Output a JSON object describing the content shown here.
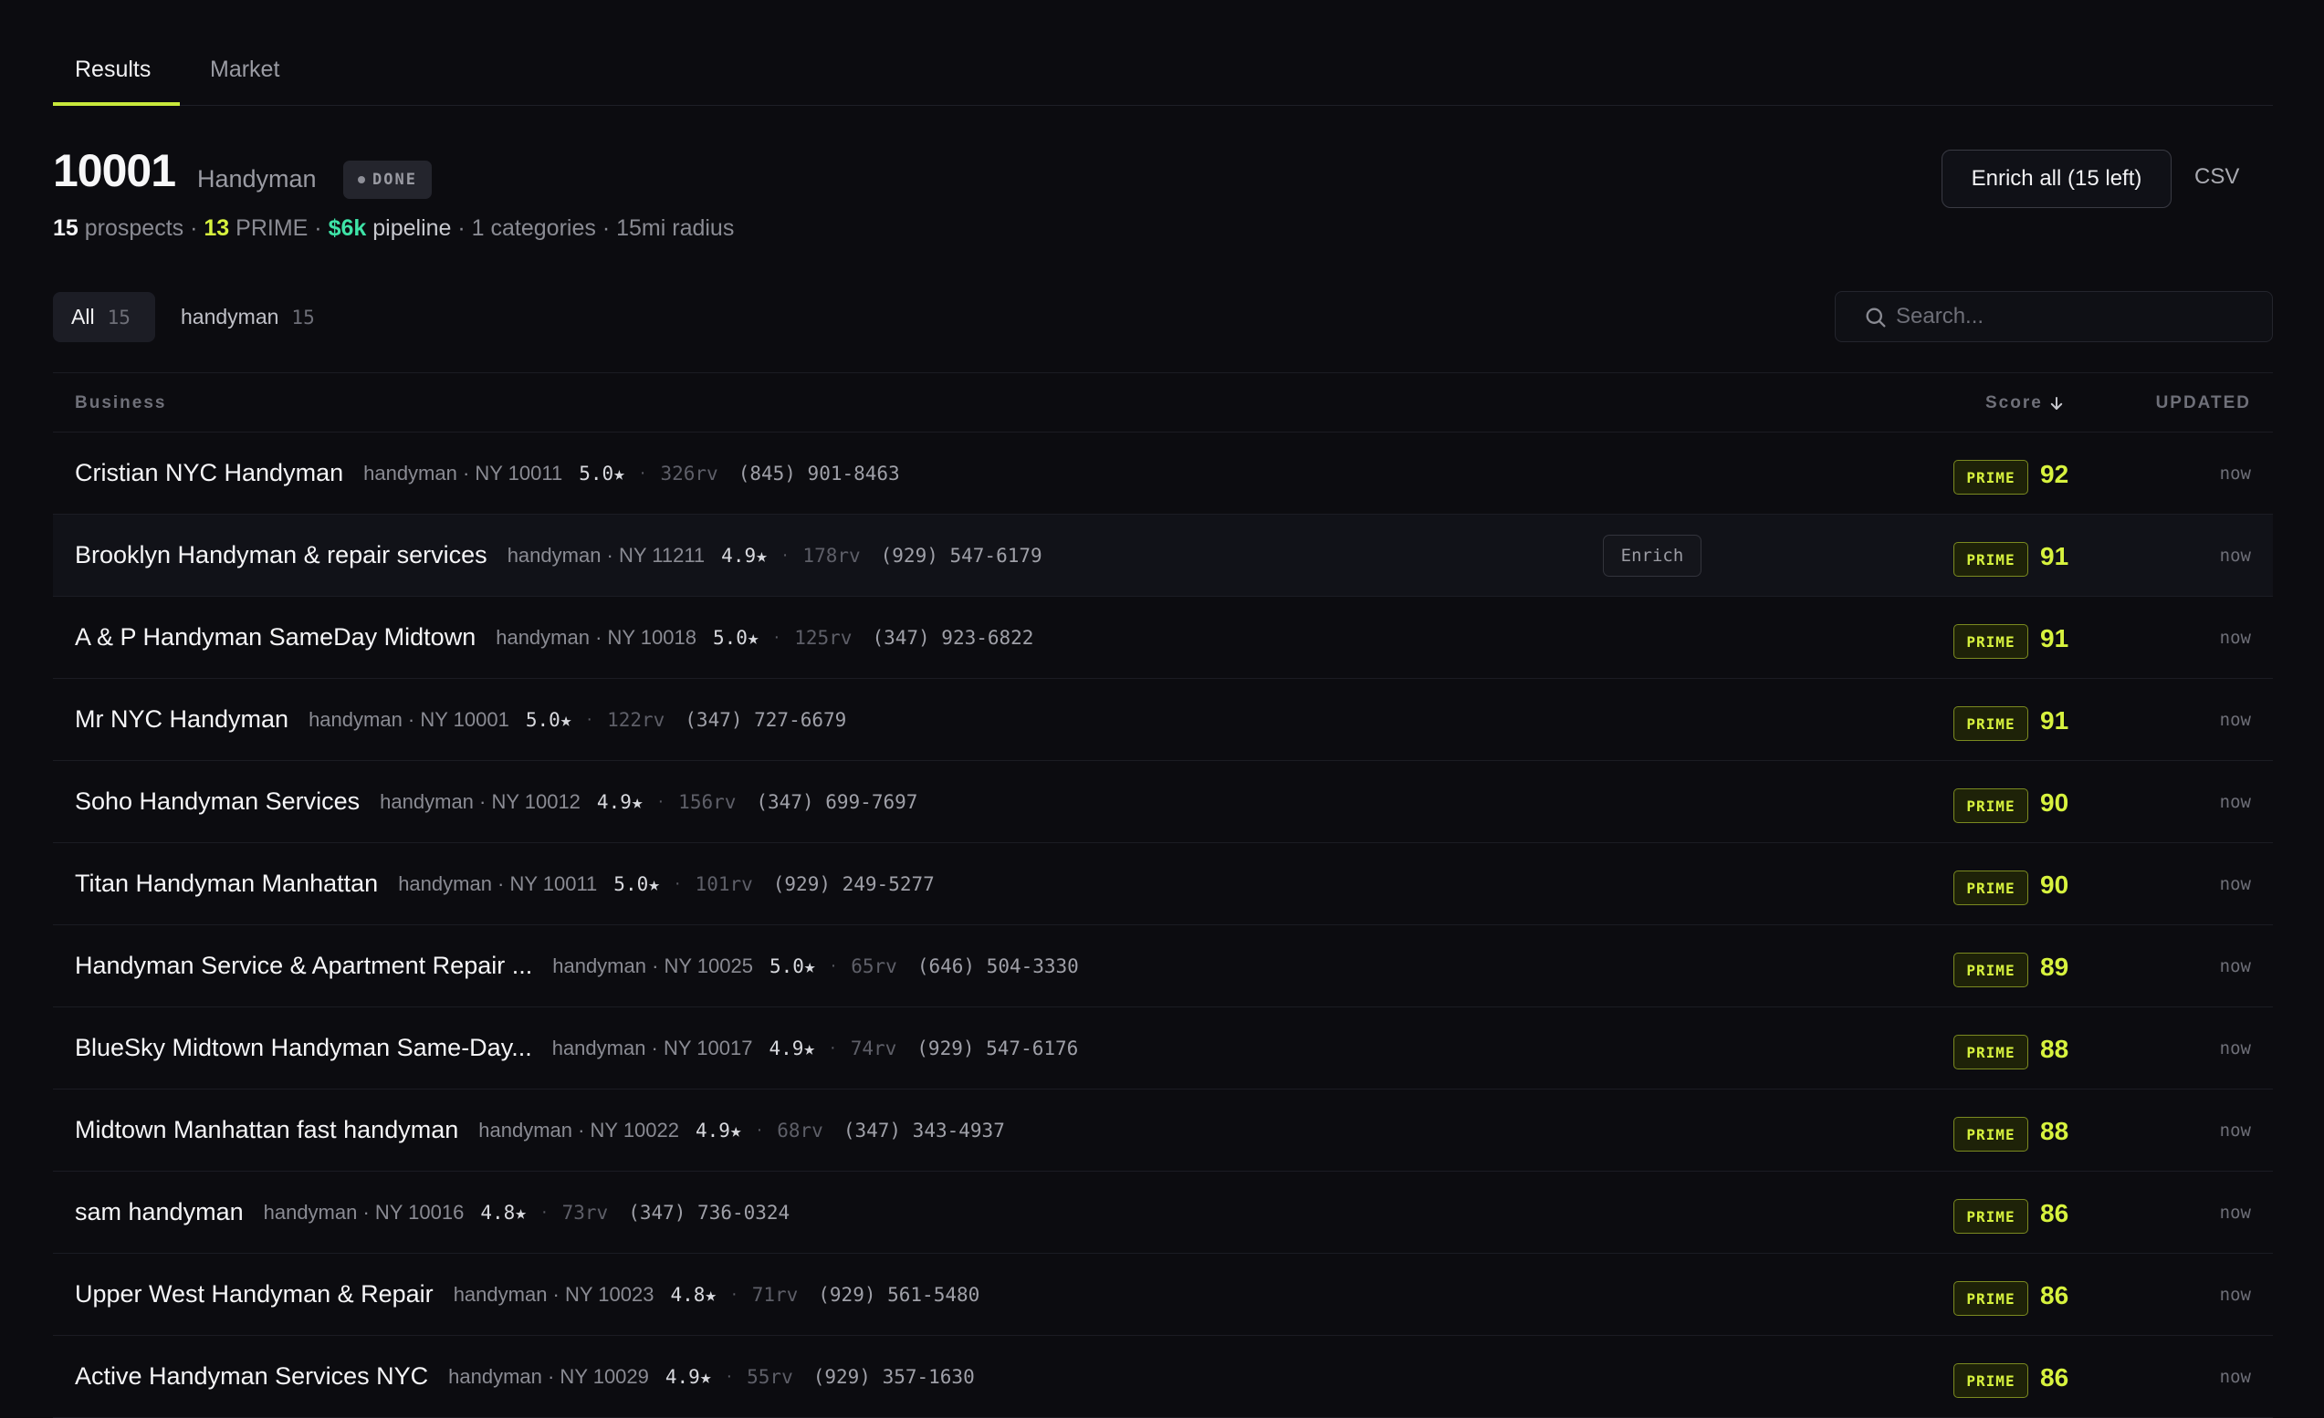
{
  "tabs": [
    {
      "label": "Results"
    },
    {
      "label": "Market"
    }
  ],
  "header": {
    "zip": "10001",
    "category": "Handyman",
    "status": "DONE",
    "summary": {
      "prospects_count": "15",
      "prospects_label": "prospects",
      "prime_count": "13",
      "prime_label": "PRIME",
      "pipeline_value": "$6k",
      "pipeline_label": "pipeline",
      "categories": "1 categories",
      "radius": "15mi radius",
      "sep": "·"
    },
    "enrich_all_label": "Enrich all (15 left)",
    "csv_label": "CSV"
  },
  "filters": [
    {
      "label": "All",
      "count": "15"
    },
    {
      "label": "handyman",
      "count": "15"
    }
  ],
  "search": {
    "placeholder": "Search..."
  },
  "table": {
    "columns": {
      "business": "Business",
      "score": "Score",
      "updated": "UPDATED"
    },
    "enrich_label": "Enrich",
    "rows": [
      {
        "name": "Cristian NYC Handyman",
        "meta": "handyman · NY 10011",
        "rating": "5.0★",
        "reviews": "326rv",
        "phone": "(845) 901-8463",
        "badge": "PRIME",
        "score": "92",
        "updated": "now"
      },
      {
        "name": "Brooklyn Handyman & repair services",
        "meta": "handyman · NY 11211",
        "rating": "4.9★",
        "reviews": "178rv",
        "phone": "(929) 547-6179",
        "badge": "PRIME",
        "score": "91",
        "updated": "now"
      },
      {
        "name": "A & P Handyman SameDay Midtown",
        "meta": "handyman · NY 10018",
        "rating": "5.0★",
        "reviews": "125rv",
        "phone": "(347) 923-6822",
        "badge": "PRIME",
        "score": "91",
        "updated": "now"
      },
      {
        "name": "Mr NYC Handyman",
        "meta": "handyman · NY 10001",
        "rating": "5.0★",
        "reviews": "122rv",
        "phone": "(347) 727-6679",
        "badge": "PRIME",
        "score": "91",
        "updated": "now"
      },
      {
        "name": "Soho Handyman Services",
        "meta": "handyman · NY 10012",
        "rating": "4.9★",
        "reviews": "156rv",
        "phone": "(347) 699-7697",
        "badge": "PRIME",
        "score": "90",
        "updated": "now"
      },
      {
        "name": "Titan Handyman Manhattan",
        "meta": "handyman · NY 10011",
        "rating": "5.0★",
        "reviews": "101rv",
        "phone": "(929) 249-5277",
        "badge": "PRIME",
        "score": "90",
        "updated": "now"
      },
      {
        "name": "Handyman Service & Apartment Repair ...",
        "meta": "handyman · NY 10025",
        "rating": "5.0★",
        "reviews": "65rv",
        "phone": "(646) 504-3330",
        "badge": "PRIME",
        "score": "89",
        "updated": "now"
      },
      {
        "name": "BlueSky Midtown Handyman Same-Day...",
        "meta": "handyman · NY 10017",
        "rating": "4.9★",
        "reviews": "74rv",
        "phone": "(929) 547-6176",
        "badge": "PRIME",
        "score": "88",
        "updated": "now"
      },
      {
        "name": "Midtown Manhattan fast handyman",
        "meta": "handyman · NY 10022",
        "rating": "4.9★",
        "reviews": "68rv",
        "phone": "(347) 343-4937",
        "badge": "PRIME",
        "score": "88",
        "updated": "now"
      },
      {
        "name": "sam handyman",
        "meta": "handyman · NY 10016",
        "rating": "4.8★",
        "reviews": "73rv",
        "phone": "(347) 736-0324",
        "badge": "PRIME",
        "score": "86",
        "updated": "now"
      },
      {
        "name": "Upper West Handyman & Repair",
        "meta": "handyman · NY 10023",
        "rating": "4.8★",
        "reviews": "71rv",
        "phone": "(929) 561-5480",
        "badge": "PRIME",
        "score": "86",
        "updated": "now"
      },
      {
        "name": "Active Handyman Services NYC",
        "meta": "handyman · NY 10029",
        "rating": "4.9★",
        "reviews": "55rv",
        "phone": "(929) 357-1630",
        "badge": "PRIME",
        "score": "86",
        "updated": "now"
      }
    ]
  },
  "colors": {
    "background": "#0c0c10",
    "accent_lime": "#d7f23e",
    "pipeline_green": "#3ee3a7",
    "tab_underline": "#c8e93b"
  }
}
